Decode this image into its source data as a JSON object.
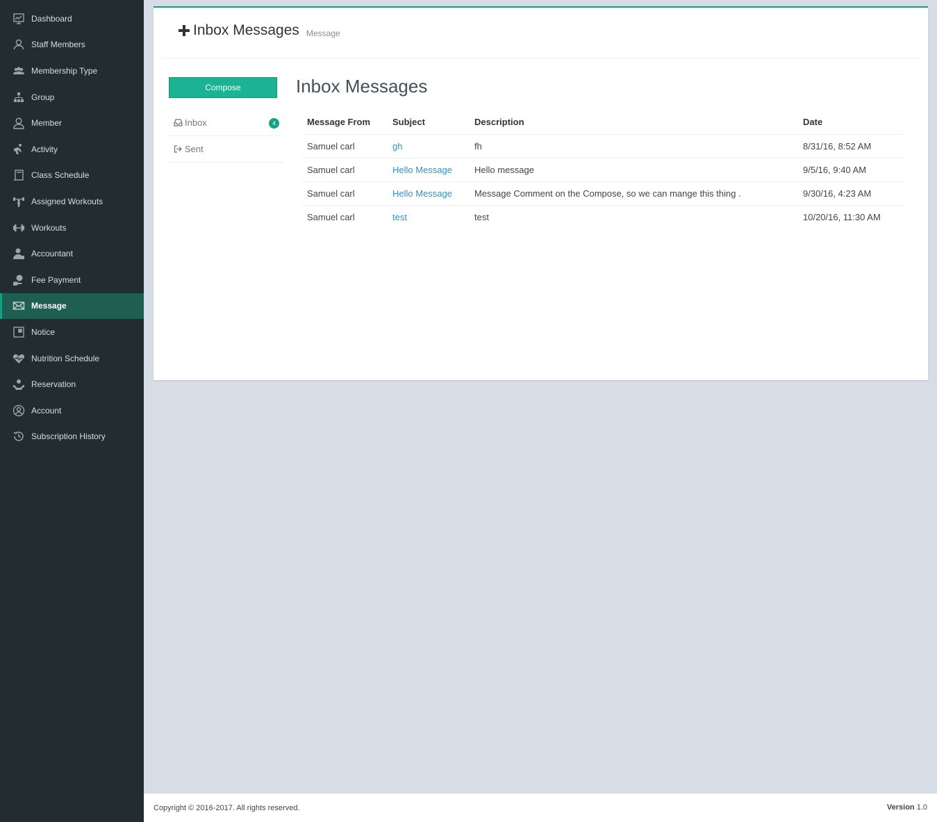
{
  "sidebar": {
    "items": [
      {
        "label": "Dashboard",
        "icon": "dashboard-icon"
      },
      {
        "label": "Staff Members",
        "icon": "staff-icon"
      },
      {
        "label": "Membership Type",
        "icon": "membership-icon"
      },
      {
        "label": "Group",
        "icon": "group-icon"
      },
      {
        "label": "Member",
        "icon": "member-icon"
      },
      {
        "label": "Activity",
        "icon": "activity-icon"
      },
      {
        "label": "Class Schedule",
        "icon": "class-schedule-icon"
      },
      {
        "label": "Assigned Workouts",
        "icon": "assigned-workouts-icon"
      },
      {
        "label": "Workouts",
        "icon": "workouts-icon"
      },
      {
        "label": "Accountant",
        "icon": "accountant-icon"
      },
      {
        "label": "Fee Payment",
        "icon": "fee-payment-icon"
      },
      {
        "label": "Message",
        "icon": "message-icon",
        "active": true
      },
      {
        "label": "Notice",
        "icon": "notice-icon"
      },
      {
        "label": "Nutrition Schedule",
        "icon": "nutrition-icon"
      },
      {
        "label": "Reservation",
        "icon": "reservation-icon"
      },
      {
        "label": "Account",
        "icon": "account-icon"
      },
      {
        "label": "Subscription History",
        "icon": "subscription-history-icon"
      }
    ]
  },
  "header": {
    "title": "Inbox Messages",
    "subtitle": "Message"
  },
  "mailbox": {
    "compose_label": "Compose",
    "inbox_label": "Inbox",
    "inbox_count": "4",
    "sent_label": "Sent"
  },
  "main": {
    "title": "Inbox Messages",
    "columns": [
      "Message From",
      "Subject",
      "Description",
      "Date"
    ],
    "rows": [
      {
        "from": "Samuel carl",
        "subject": "gh",
        "description": "fh",
        "date": "8/31/16, 8:52 AM"
      },
      {
        "from": "Samuel carl",
        "subject": "Hello Message",
        "description": "Hello message",
        "date": "9/5/16, 9:40 AM"
      },
      {
        "from": "Samuel carl",
        "subject": "Hello Message",
        "description": "Message Comment on the Compose, so we can mange this thing .",
        "date": "9/30/16, 4:23 AM"
      },
      {
        "from": "Samuel carl",
        "subject": "test",
        "description": "test",
        "date": "10/20/16, 11:30 AM"
      }
    ]
  },
  "footer": {
    "copyright": "Copyright © 2016-2017. All rights reserved.",
    "version_label": "Version",
    "version_number": "1.0"
  },
  "colors": {
    "sidebar_bg": "#222d32",
    "accent": "#17a085",
    "active_bg": "#1e5f52",
    "link": "#3c8dbc"
  }
}
